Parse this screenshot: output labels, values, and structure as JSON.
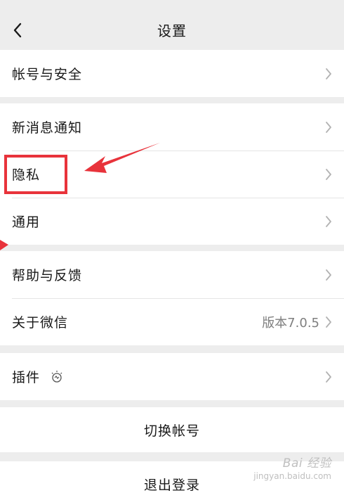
{
  "navbar": {
    "title": "设置"
  },
  "groups": [
    {
      "items": [
        {
          "label": "帐号与安全"
        }
      ]
    },
    {
      "items": [
        {
          "label": "新消息通知"
        },
        {
          "label": "隐私"
        },
        {
          "label": "通用"
        }
      ]
    },
    {
      "items": [
        {
          "label": "帮助与反馈"
        },
        {
          "label": "关于微信",
          "value": "版本7.0.5"
        }
      ]
    },
    {
      "items": [
        {
          "label": "插件",
          "icon": "plugin-bulb-icon"
        }
      ]
    }
  ],
  "actions": {
    "switch_account": "切换帐号",
    "logout": "退出登录"
  },
  "icons": {
    "back": "chevron-left-icon",
    "row_arrow": "chevron-right-icon"
  },
  "colors": {
    "annotation": "#e8333b",
    "background": "#ededed",
    "cell": "#ffffff"
  },
  "watermark": {
    "brand": "Bai 经验",
    "url": "jingyan.baidu.com"
  }
}
